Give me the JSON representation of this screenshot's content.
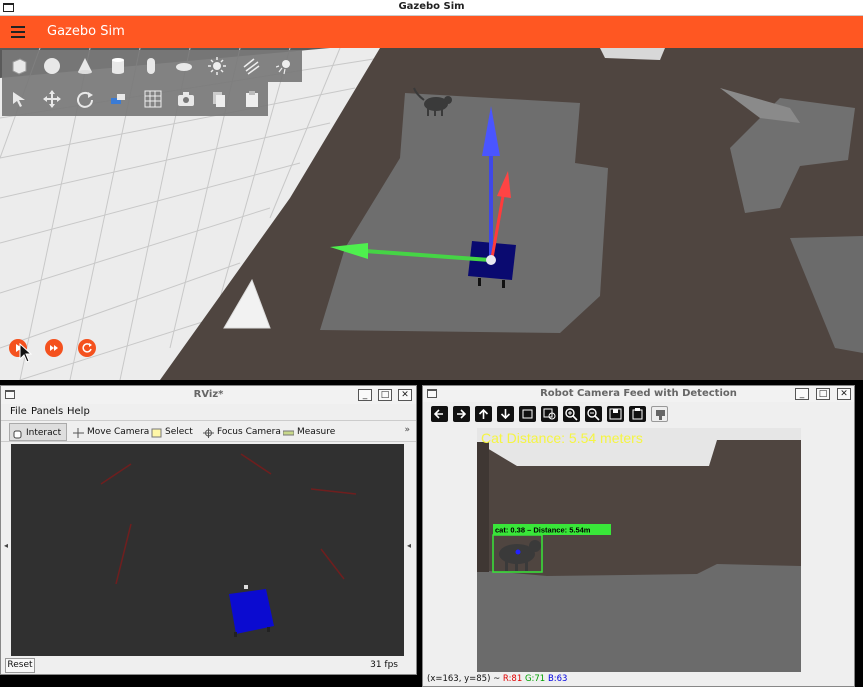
{
  "gazebo": {
    "window_title": "Gazebo Sim",
    "app_title": "Gazebo Sim",
    "toolbar_row1_icons": [
      "box-shape-icon",
      "sphere-shape-icon",
      "cone-shape-icon",
      "cylinder-shape-icon",
      "capsule-shape-icon",
      "ellipsoid-shape-icon",
      "point-light-icon",
      "directional-light-icon",
      "spot-light-icon"
    ],
    "toolbar_row2_icons": [
      "select-mode-icon",
      "translate-mode-icon",
      "rotate-mode-icon",
      "view-angle-icon",
      "grid-config-icon",
      "screenshot-icon",
      "copy-icon",
      "paste-icon"
    ],
    "playback_icons": [
      "play-icon",
      "step-icon",
      "reset-icon"
    ],
    "colors": {
      "accent": "#ff5722",
      "button": "#f4511e"
    }
  },
  "rviz": {
    "window_title": "RViz*",
    "menu": [
      "File",
      "Panels",
      "Help"
    ],
    "tools": [
      "Interact",
      "Move Camera",
      "Select",
      "Focus Camera",
      "Measure"
    ],
    "reset_label": "Reset",
    "fps": "31 fps",
    "more": "»",
    "left_handle": "◂",
    "right_handle": "◂"
  },
  "camera": {
    "window_title": "Robot Camera Feed with Detection",
    "overlay_text": "Cat Distance: 5.54 meters",
    "detection_label": "cat: 0.38 – Distance: 5.54m",
    "status_coords": "(x=163, y=85) ~",
    "status_r": "R:81",
    "status_g": "G:71",
    "status_b": "B:63",
    "colors": {
      "overlay": "#f5f542",
      "box": "#39e639"
    }
  },
  "window_buttons": {
    "minimize": "_",
    "maximize": "□",
    "close": "✕"
  }
}
